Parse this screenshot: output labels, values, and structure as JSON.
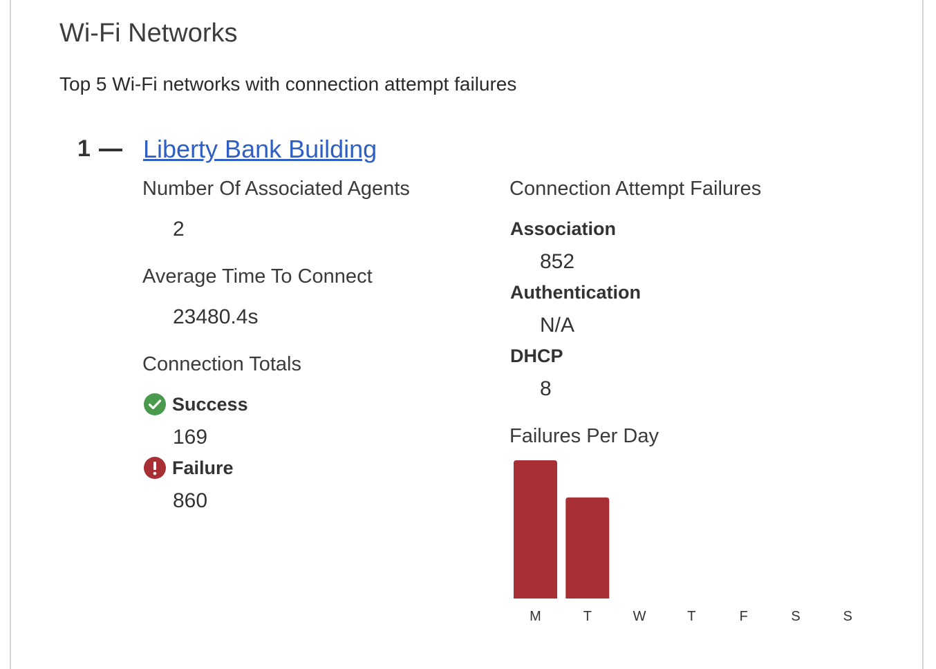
{
  "header": {
    "title": "Wi-Fi Networks",
    "subtitle": "Top 5 Wi-Fi networks with connection attempt failures"
  },
  "network": {
    "rank": "1",
    "name": "Liberty Bank Building",
    "associated_agents": {
      "label": "Number Of Associated Agents",
      "value": "2"
    },
    "avg_time": {
      "label": "Average Time To Connect",
      "value": "23480.4s"
    },
    "totals": {
      "label": "Connection Totals",
      "success": {
        "label": "Success",
        "value": "169",
        "icon": "check-circle-icon",
        "color": "#4a9a4e"
      },
      "failure": {
        "label": "Failure",
        "value": "860",
        "icon": "exclamation-circle-icon",
        "color": "#a83034"
      }
    },
    "failures": {
      "label": "Connection Attempt Failures",
      "association": {
        "label": "Association",
        "value": "852"
      },
      "authentication": {
        "label": "Authentication",
        "value": "N/A"
      },
      "dhcp": {
        "label": "DHCP",
        "value": "8"
      }
    },
    "per_day_label": "Failures Per Day"
  },
  "chart_data": {
    "type": "bar",
    "categories": [
      "M",
      "T",
      "W",
      "T",
      "F",
      "S",
      "S"
    ],
    "values": [
      540,
      395,
      0,
      0,
      0,
      0,
      0
    ],
    "ylim": [
      0,
      540
    ],
    "bar_color": "#a83034",
    "grid": false
  }
}
